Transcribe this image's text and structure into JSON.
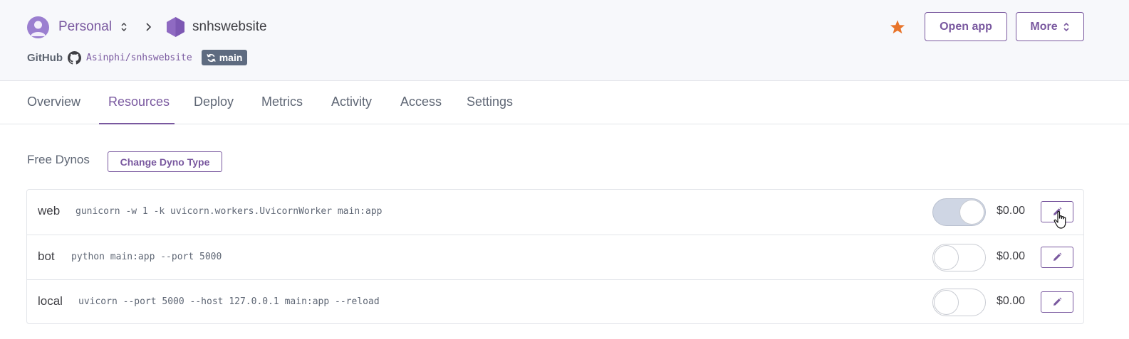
{
  "breadcrumb": {
    "account": "Personal",
    "app_name": "snhswebsite"
  },
  "repo": {
    "provider": "GitHub",
    "name": "Asinphi/snhswebsite",
    "branch": "main"
  },
  "actions": {
    "favorite_icon": "star-icon",
    "open_app": "Open app",
    "more": "More"
  },
  "tabs": [
    {
      "label": "Overview"
    },
    {
      "label": "Resources",
      "active": true
    },
    {
      "label": "Deploy"
    },
    {
      "label": "Metrics"
    },
    {
      "label": "Activity"
    },
    {
      "label": "Access"
    },
    {
      "label": "Settings"
    }
  ],
  "dynos_section": {
    "title": "Free Dynos",
    "change_button": "Change Dyno Type",
    "items": [
      {
        "name": "web",
        "command": "gunicorn -w 1 -k uvicorn.workers.UvicornWorker main:app",
        "enabled": true,
        "price": "$0.00"
      },
      {
        "name": "bot",
        "command": "python main:app --port 5000",
        "enabled": false,
        "price": "$0.00"
      },
      {
        "name": "local",
        "command": "uvicorn --port 5000 --host 127.0.0.1 main:app --reload",
        "enabled": false,
        "price": "$0.00"
      }
    ]
  },
  "colors": {
    "accent": "#79589f",
    "star": "#e8742a",
    "badge": "#5e6b80"
  }
}
